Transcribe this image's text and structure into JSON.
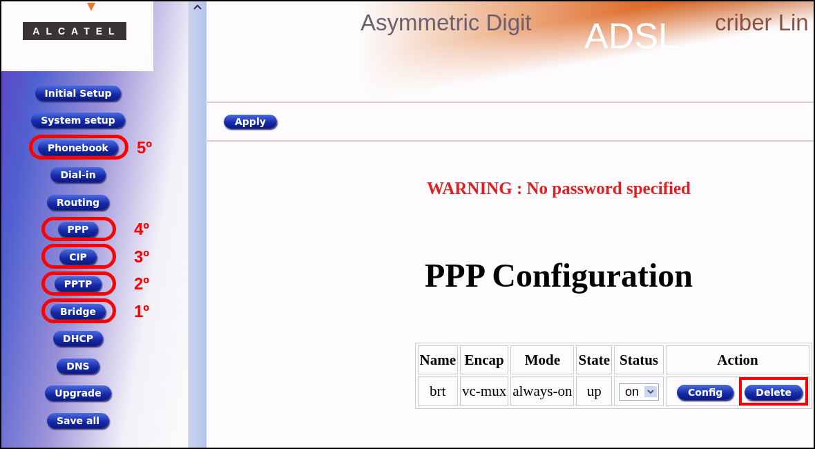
{
  "sidebar": {
    "logo": "ALCATEL",
    "items": [
      {
        "label": "Initial Setup",
        "circled": false
      },
      {
        "label": "System setup",
        "circled": false
      },
      {
        "label": "Phonebook",
        "circled": true,
        "step": "5º"
      },
      {
        "label": "Dial-in",
        "circled": false
      },
      {
        "label": "Routing",
        "circled": false
      },
      {
        "label": "PPP",
        "circled": true,
        "step": "4º"
      },
      {
        "label": "CIP",
        "circled": true,
        "step": "3º"
      },
      {
        "label": "PPTP",
        "circled": true,
        "step": "2º"
      },
      {
        "label": "Bridge",
        "circled": true,
        "step": "1º"
      },
      {
        "label": "DHCP",
        "circled": false
      },
      {
        "label": "DNS",
        "circled": false
      },
      {
        "label": "Upgrade",
        "circled": false
      },
      {
        "label": "Save all",
        "circled": false
      }
    ]
  },
  "banner": {
    "tagline_left": "Asymmetric Digit",
    "tagline_right": "criber Lin",
    "logo": "ADSL"
  },
  "toolbar": {
    "apply": "Apply"
  },
  "warning": "WARNING : No password specified",
  "title": "PPP Configuration",
  "table": {
    "columns": [
      "Name",
      "Encap",
      "Mode",
      "State",
      "Status",
      "Action"
    ],
    "rows": [
      {
        "name": "brt",
        "encap": "vc-mux",
        "mode": "always-on",
        "state": "up",
        "status": "on",
        "actions": [
          {
            "label": "Config",
            "boxed": false
          },
          {
            "label": "Delete",
            "boxed": true
          }
        ]
      }
    ]
  }
}
